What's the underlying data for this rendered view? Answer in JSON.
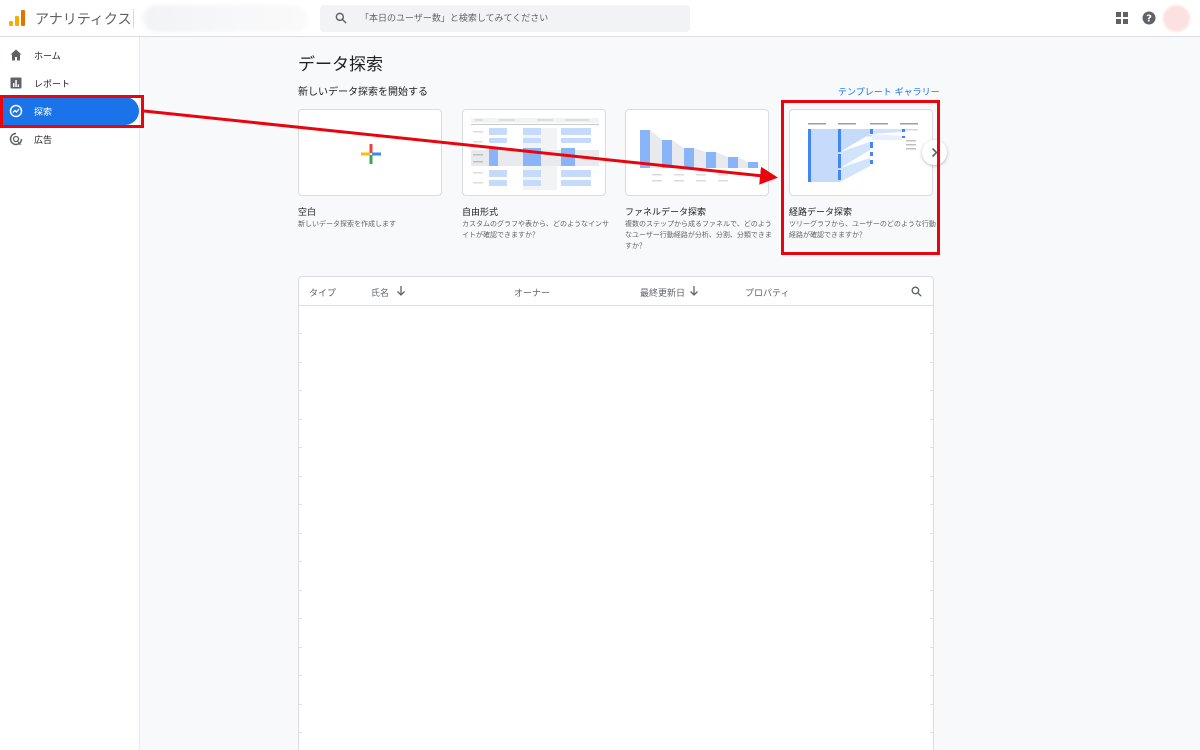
{
  "app": {
    "name": "アナリティクス"
  },
  "search": {
    "placeholder": "「本日のユーザー数」と検索してみてください"
  },
  "sidebar": {
    "items": [
      {
        "label": "ホーム",
        "icon": "home-icon"
      },
      {
        "label": "レポート",
        "icon": "reports-icon"
      },
      {
        "label": "探索",
        "icon": "explore-icon",
        "active": true
      },
      {
        "label": "広告",
        "icon": "advertising-icon"
      }
    ]
  },
  "main": {
    "title": "データ探索",
    "section_title": "新しいデータ探索を開始する",
    "gallery_link": "テンプレート ギャラリー",
    "cards": [
      {
        "title": "空白",
        "desc": "新しいデータ探索を作成します"
      },
      {
        "title": "自由形式",
        "desc": "カスタムのグラフや表から、どのようなインサイトが確認できますか？"
      },
      {
        "title": "ファネルデータ探索",
        "desc": "複数のステップから成るファネルで、どのようなユーザー行動経路が分析、分割、分類できますか？"
      },
      {
        "title": "経路データ探索",
        "desc": "ツリーグラフから、ユーザーのどのような行動経路が確認できますか？"
      }
    ]
  },
  "table": {
    "columns": [
      "タイプ",
      "氏名",
      "オーナー",
      "最終更新日",
      "プロパティ"
    ]
  },
  "colors": {
    "accent": "#1a73e8",
    "annotation": "#e8050d",
    "logo": "#f9ab00"
  }
}
